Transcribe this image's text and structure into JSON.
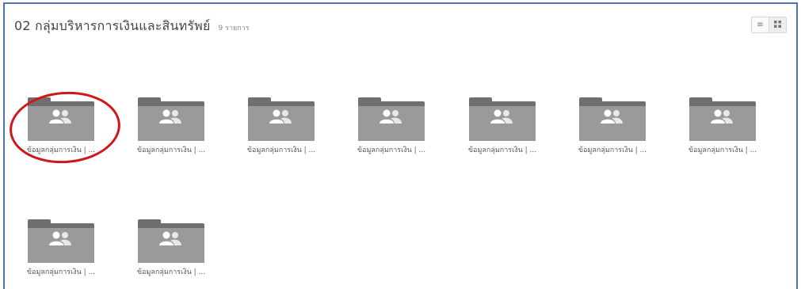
{
  "header": {
    "title": "02 กลุ่มบริหารการเงินและสินทรัพย์",
    "count": "9 รายการ"
  },
  "view_switch": {
    "list_icon": "list-view-icon",
    "grid_icon": "grid-view-icon",
    "list_glyph": "≡",
    "grid_glyph": "▪▪"
  },
  "folders": [
    {
      "label": "ข้อมูลกลุ่มการเงิน | ...",
      "icon": "shared-folder-icon"
    },
    {
      "label": "ข้อมูลกลุ่มการเงิน | ...",
      "icon": "shared-folder-icon"
    },
    {
      "label": "ข้อมูลกลุ่มการเงิน | ...",
      "icon": "shared-folder-icon"
    },
    {
      "label": "ข้อมูลกลุ่มการเงิน | ...",
      "icon": "shared-folder-icon"
    },
    {
      "label": "ข้อมูลกลุ่มการเงิน | ...",
      "icon": "shared-folder-icon"
    },
    {
      "label": "ข้อมูลกลุ่มการเงิน | ...",
      "icon": "shared-folder-icon"
    },
    {
      "label": "ข้อมูลกลุ่มการเงิน | ...",
      "icon": "shared-folder-icon"
    },
    {
      "label": "ข้อมูลกลุ่มการเงิน | ...",
      "icon": "shared-folder-icon"
    },
    {
      "label": "ข้อมูลกลุ่มการเงิน | ...",
      "icon": "shared-folder-icon"
    }
  ],
  "colors": {
    "frame_border": "#4a76b4",
    "folder_front": "#9a9a9a",
    "folder_back": "#6f6f6f",
    "highlight": "#d01616"
  }
}
